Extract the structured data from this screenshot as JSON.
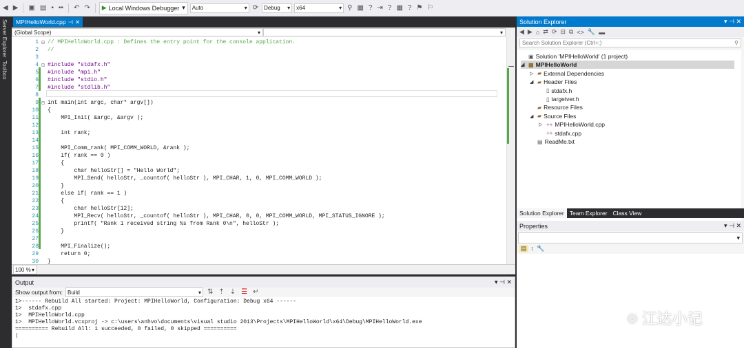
{
  "toolbar": {
    "run_label": "Local Windows Debugger",
    "solution_config": "Auto",
    "build_config": "Debug",
    "platform": "x64"
  },
  "side_tabs": [
    "Server Explorer",
    "Toolbox"
  ],
  "editor": {
    "tab_name": "MPIHelloWorld.cpp",
    "scope": "(Global Scope)",
    "zoom": "100 %",
    "lines": [
      {
        "n": "1",
        "text": "// MPIHelloWorld.cpp : Defines the entry point for the console application.",
        "cls": "c"
      },
      {
        "n": "2",
        "text": "//",
        "cls": "c"
      },
      {
        "n": "3",
        "text": "",
        "cls": "t"
      },
      {
        "n": "4",
        "text": "#include \"stdafx.h\"",
        "cls": "p"
      },
      {
        "n": "5",
        "text": "#include \"mpi.h\"",
        "cls": "p"
      },
      {
        "n": "6",
        "text": "#include \"stdio.h\"",
        "cls": "p"
      },
      {
        "n": "7",
        "text": "#include \"stdlib.h\"",
        "cls": "p"
      },
      {
        "n": "8",
        "text": "",
        "cls": "t"
      },
      {
        "n": "9",
        "text": "int main(int argc, char* argv[])",
        "cls": "t"
      },
      {
        "n": "10",
        "text": "{",
        "cls": "t"
      },
      {
        "n": "11",
        "text": "    MPI_Init( &argc, &argv );",
        "cls": "t"
      },
      {
        "n": "12",
        "text": "",
        "cls": "t"
      },
      {
        "n": "13",
        "text": "    int rank;",
        "cls": "t"
      },
      {
        "n": "14",
        "text": "",
        "cls": "t"
      },
      {
        "n": "15",
        "text": "    MPI_Comm_rank( MPI_COMM_WORLD, &rank );",
        "cls": "t"
      },
      {
        "n": "16",
        "text": "    if( rank == 0 )",
        "cls": "t"
      },
      {
        "n": "17",
        "text": "    {",
        "cls": "t"
      },
      {
        "n": "18",
        "text": "        char helloStr[] = \"Hello World\";",
        "cls": "t"
      },
      {
        "n": "19",
        "text": "        MPI_Send( helloStr, _countof( helloStr ), MPI_CHAR, 1, 0, MPI_COMM_WORLD );",
        "cls": "t"
      },
      {
        "n": "20",
        "text": "    }",
        "cls": "t"
      },
      {
        "n": "21",
        "text": "    else if( rank == 1 )",
        "cls": "t"
      },
      {
        "n": "22",
        "text": "    {",
        "cls": "t"
      },
      {
        "n": "23",
        "text": "        char helloStr[12];",
        "cls": "t"
      },
      {
        "n": "24",
        "text": "        MPI_Recv( helloStr, _countof( helloStr ), MPI_CHAR, 0, 0, MPI_COMM_WORLD, MPI_STATUS_IGNORE );",
        "cls": "t"
      },
      {
        "n": "25",
        "text": "        printf( \"Rank 1 received string %s from Rank 0\\n\", helloStr );",
        "cls": "t"
      },
      {
        "n": "26",
        "text": "    }",
        "cls": "t"
      },
      {
        "n": "27",
        "text": "",
        "cls": "t"
      },
      {
        "n": "28",
        "text": "    MPI_Finalize();",
        "cls": "t"
      },
      {
        "n": "29",
        "text": "    return 0;",
        "cls": "t"
      },
      {
        "n": "30",
        "text": "}",
        "cls": "t"
      }
    ]
  },
  "output": {
    "title": "Output",
    "show_from_label": "Show output from:",
    "source": "Build",
    "lines": [
      "1>------ Rebuild All started: Project: MPIHelloWorld, Configuration: Debug x64 ------",
      "1>  stdafx.cpp",
      "1>  MPIHelloWorld.cpp",
      "1>  MPIHelloWorld.vcxproj -> c:\\users\\anhvo\\documents\\visual studio 2013\\Projects\\MPIHelloWorld\\x64\\Debug\\MPIHelloWorld.exe",
      "========== Rebuild All: 1 succeeded, 0 failed, 0 skipped ==========",
      "|"
    ]
  },
  "solution_explorer": {
    "title": "Solution Explorer",
    "search_placeholder": "Search Solution Explorer (Ctrl+;)",
    "nodes": [
      {
        "label": "Solution 'MPIHelloWorld' (1 project)",
        "depth": 0,
        "arrow": "",
        "icon": "solution-icon"
      },
      {
        "label": "MPIHelloWorld",
        "depth": 0,
        "arrow": "◢",
        "icon": "project-icon"
      },
      {
        "label": "External Dependencies",
        "depth": 1,
        "arrow": "▷",
        "icon": "folder-icon"
      },
      {
        "label": "Header Files",
        "depth": 1,
        "arrow": "◢",
        "icon": "folder-icon"
      },
      {
        "label": "stdafx.h",
        "depth": 2,
        "arrow": "",
        "icon": "header-file-icon"
      },
      {
        "label": "targetver.h",
        "depth": 2,
        "arrow": "",
        "icon": "header-file-icon"
      },
      {
        "label": "Resource Files",
        "depth": 1,
        "arrow": "",
        "icon": "folder-icon"
      },
      {
        "label": "Source Files",
        "depth": 1,
        "arrow": "◢",
        "icon": "folder-icon"
      },
      {
        "label": "MPIHelloWorld.cpp",
        "depth": 2,
        "arrow": "▷",
        "icon": "cpp-file-icon"
      },
      {
        "label": "stdafx.cpp",
        "depth": 2,
        "arrow": "",
        "icon": "cpp-file-icon"
      },
      {
        "label": "ReadMe.txt",
        "depth": 1,
        "arrow": "",
        "icon": "text-file-icon"
      }
    ],
    "tabs": [
      "Solution Explorer",
      "Team Explorer",
      "Class View"
    ]
  },
  "properties": {
    "title": "Properties"
  },
  "watermark": "江达小记"
}
